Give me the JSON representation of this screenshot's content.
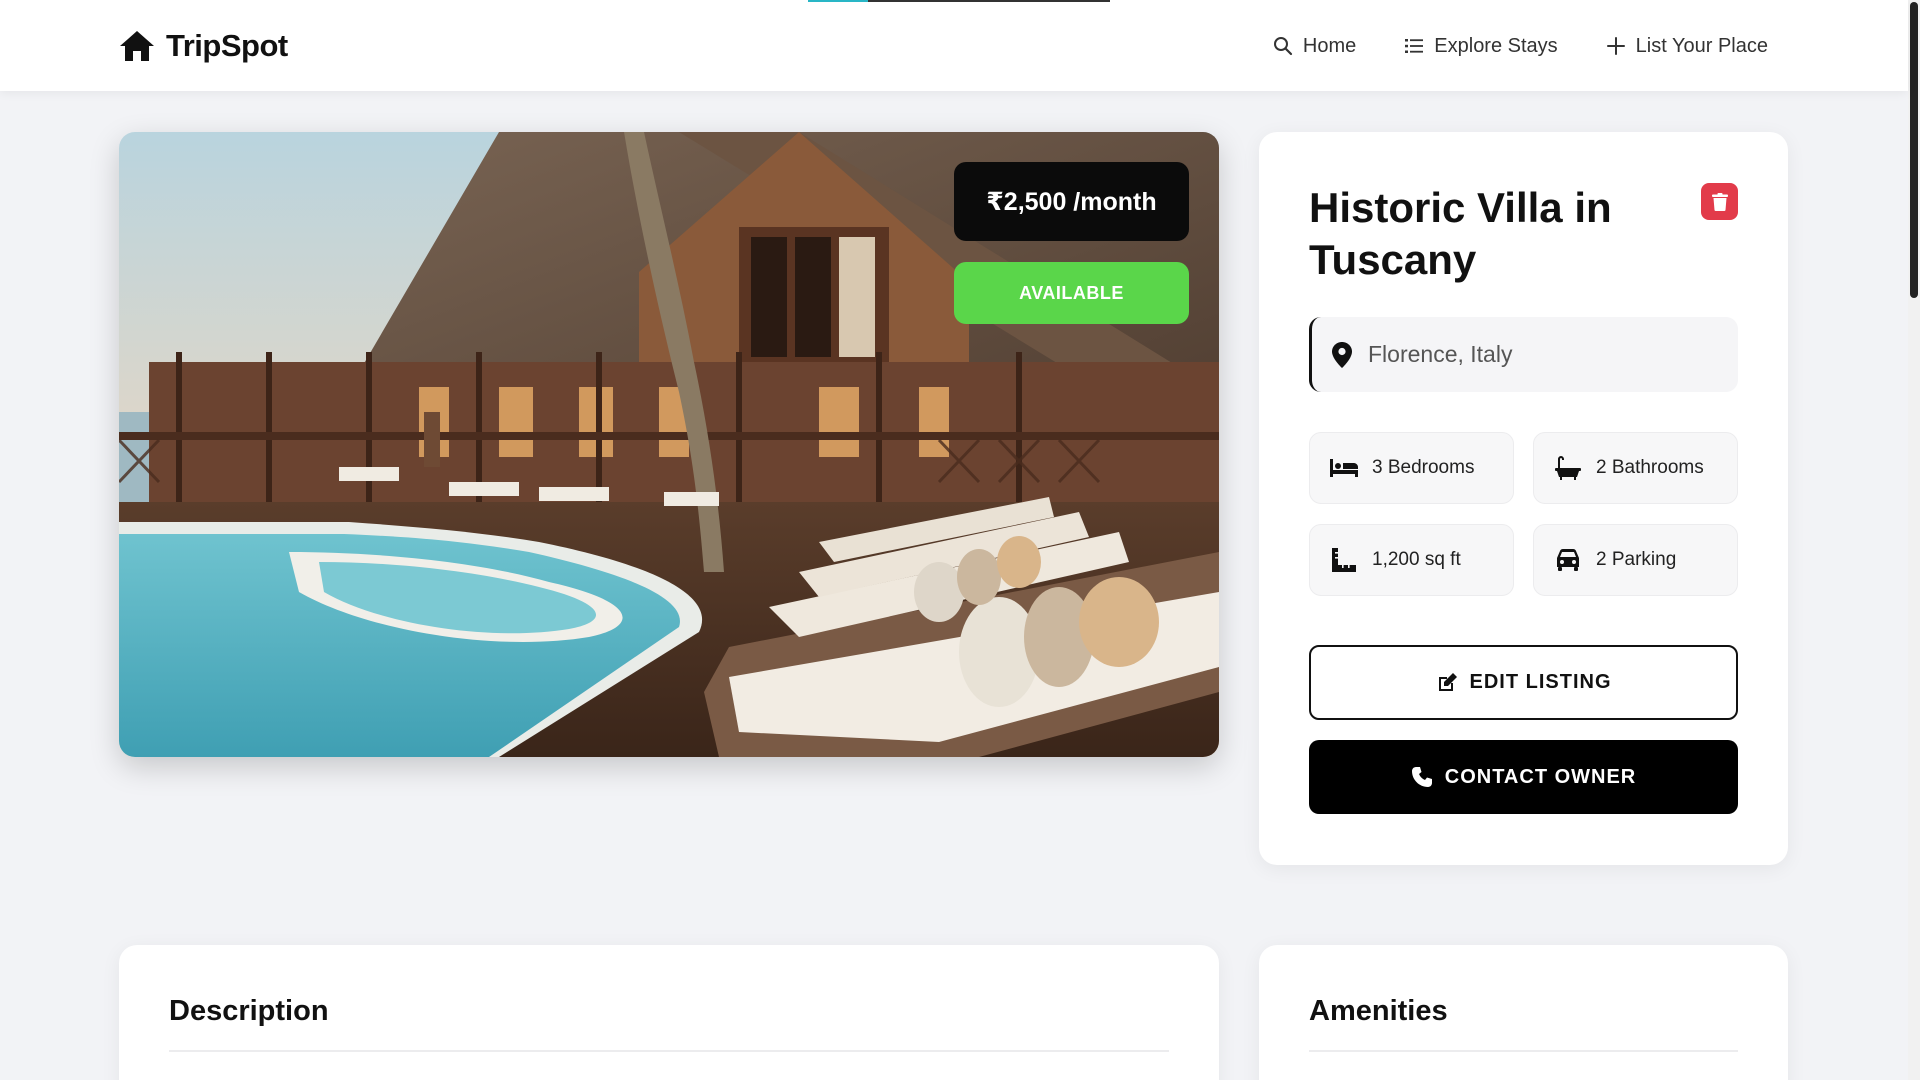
{
  "nav": {
    "brand": "TripSpot",
    "brand_icon": "home-icon",
    "loading_progress": 0.2,
    "links": [
      {
        "label": "Home",
        "icon": "search-icon"
      },
      {
        "label": "Explore Stays",
        "icon": "list-icon"
      },
      {
        "label": "List Your Place",
        "icon": "plus-icon"
      }
    ]
  },
  "hero": {
    "price": "₹2,500 /month",
    "status": "AVAILABLE",
    "image_icon": "resort-pool-photo"
  },
  "listing": {
    "title": "Historic Villa in Tuscany",
    "location": "Florence, Italy",
    "features": [
      {
        "label": "3 Bedrooms",
        "icon": "bed-icon"
      },
      {
        "label": "2 Bathrooms",
        "icon": "bath-icon"
      },
      {
        "label": "1,200 sq ft",
        "icon": "ruler-icon"
      },
      {
        "label": "2 Parking",
        "icon": "car-icon"
      }
    ],
    "edit_label": "EDIT LISTING",
    "contact_label": "CONTACT OWNER"
  },
  "sections": {
    "description_title": "Description",
    "amenities_title": "Amenities"
  },
  "colors": {
    "available": "#5ad64a",
    "delete": "#e23b4a",
    "progress": "#29b6c6",
    "primary": "#000000"
  }
}
